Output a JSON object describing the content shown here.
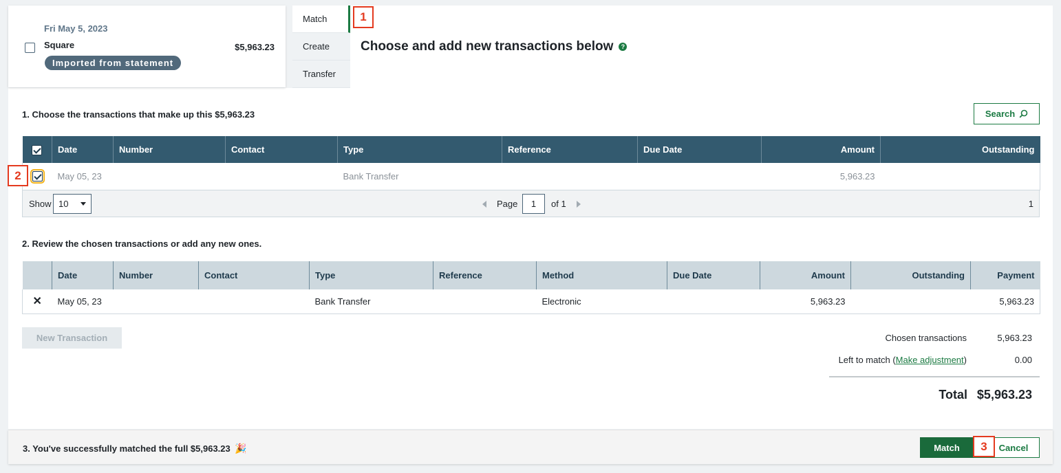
{
  "statement": {
    "date": "Fri May 5, 2023",
    "payee": "Square",
    "amount": "$5,963.23",
    "badge": "Imported from statement"
  },
  "tabs": [
    {
      "label": "Match",
      "active": true
    },
    {
      "label": "Create",
      "active": false
    },
    {
      "label": "Transfer",
      "active": false
    }
  ],
  "heading": "Choose and add new transactions below",
  "help_icon": "?",
  "markers": [
    "1",
    "2",
    "3"
  ],
  "step1": {
    "label": "1. Choose the transactions that make up this $5,963.23",
    "search_label": "Search",
    "columns": [
      "Date",
      "Number",
      "Contact",
      "Type",
      "Reference",
      "Due Date",
      "Amount",
      "Outstanding"
    ],
    "rows": [
      {
        "checked": true,
        "date": "May 05, 23",
        "number": "",
        "contact": "",
        "type": "Bank Transfer",
        "reference": "",
        "due_date": "",
        "amount": "5,963.23",
        "outstanding": ""
      }
    ],
    "pager": {
      "show_label": "Show",
      "page_size": "10",
      "page_label": "Page",
      "page": "1",
      "of_label": "of 1",
      "count": "1"
    }
  },
  "step2": {
    "label": "2. Review the chosen transactions or add any new ones.",
    "columns": [
      "Date",
      "Number",
      "Contact",
      "Type",
      "Reference",
      "Method",
      "Due Date",
      "Amount",
      "Outstanding",
      "Payment"
    ],
    "rows": [
      {
        "date": "May 05, 23",
        "number": "",
        "contact": "",
        "type": "Bank Transfer",
        "reference": "",
        "method": "Electronic",
        "due_date": "",
        "amount": "5,963.23",
        "outstanding": "",
        "payment": "5,963.23"
      }
    ],
    "new_transaction_label": "New Transaction"
  },
  "summary": {
    "chosen_label": "Chosen transactions",
    "chosen_value": "5,963.23",
    "left_label_prefix": "Left to match (",
    "left_link": "Make adjustment",
    "left_label_suffix": ")",
    "left_value": "0.00",
    "total_label": "Total",
    "total_value": "$5,963.23"
  },
  "step3": {
    "label": "3. You've successfully matched the full $5,963.23",
    "emoji": "🎉"
  },
  "actions": {
    "match_label": "Match",
    "cancel_label": "Cancel"
  }
}
